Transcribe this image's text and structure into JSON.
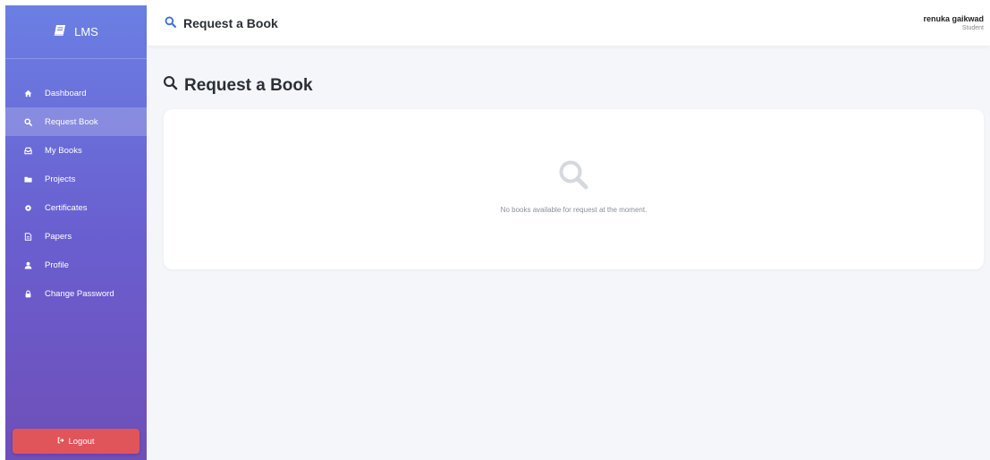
{
  "app": {
    "brand": "LMS",
    "brand_icon": "book-icon"
  },
  "sidebar": {
    "items": [
      {
        "label": "Dashboard",
        "icon": "home-icon",
        "active": false
      },
      {
        "label": "Request Book",
        "icon": "search-icon",
        "active": true
      },
      {
        "label": "My Books",
        "icon": "inbox-icon",
        "active": false
      },
      {
        "label": "Projects",
        "icon": "folder-icon",
        "active": false
      },
      {
        "label": "Certificates",
        "icon": "certificate-icon",
        "active": false
      },
      {
        "label": "Papers",
        "icon": "file-icon",
        "active": false
      },
      {
        "label": "Profile",
        "icon": "user-icon",
        "active": false
      },
      {
        "label": "Change Password",
        "icon": "lock-icon",
        "active": false
      }
    ],
    "logout_label": "Logout",
    "logout_icon": "sign-out-icon"
  },
  "header": {
    "title": "Request a Book",
    "title_icon": "search-icon",
    "user_name": "renuka gaikwad",
    "user_role": "Student"
  },
  "main": {
    "heading": "Request a Book",
    "empty_message": "No books available for request at the moment.",
    "empty_icon": "search-icon"
  },
  "colors": {
    "sidebar_top": "#6b7fe3",
    "sidebar_bottom": "#6f4fb8",
    "logout": "#e0555a",
    "header_icon": "#3d6fd8",
    "background": "#f4f6fa"
  }
}
